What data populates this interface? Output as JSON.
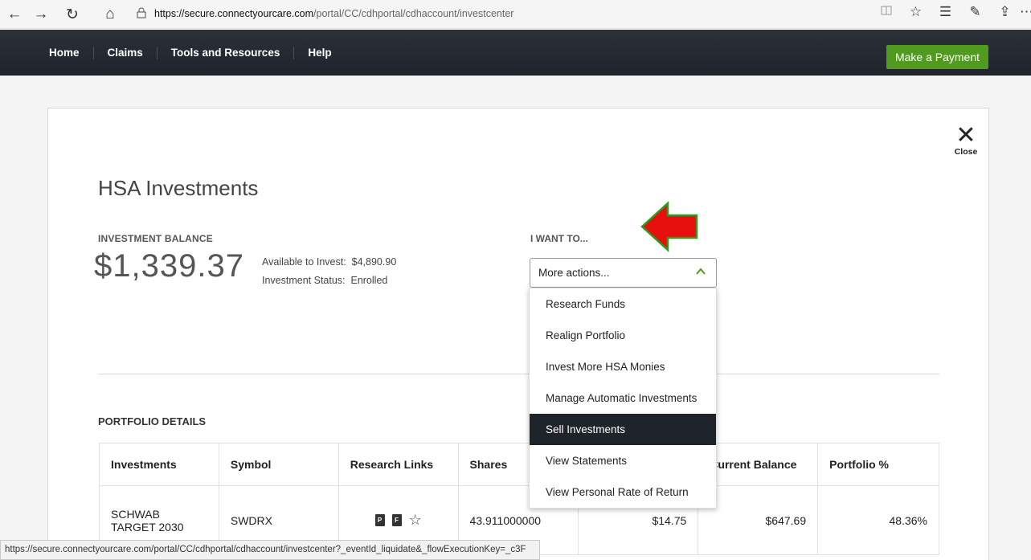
{
  "browser": {
    "url_host": "https://secure.connectyourcare.com",
    "url_path": "/portal/CC/cdhportal/cdhaccount/investcenter",
    "status_url": "https://secure.connectyourcare.com/portal/CC/cdhportal/cdhaccount/investcenter?_eventId_liquidate&_flowExecutionKey=_c3F",
    "icons": {
      "back": "←",
      "forward": "→",
      "refresh": "↻",
      "home": "⌂",
      "lock": "🔒",
      "reading": "📖",
      "favorite": "☆",
      "favorites_list": "☰",
      "pen": "✎",
      "share": "⇪",
      "more": "⋯"
    }
  },
  "topnav": {
    "items": [
      "Home",
      "Claims",
      "Tools and Resources",
      "Help"
    ],
    "payment_button": "Make a Payment"
  },
  "close": {
    "icon": "✕",
    "label": "Close"
  },
  "page_title": "HSA Investments",
  "balance": {
    "label": "INVESTMENT BALANCE",
    "amount": "$1,339.37",
    "available_label": "Available to Invest:",
    "available_value": "$4,890.90",
    "status_label": "Investment Status:",
    "status_value": "Enrolled"
  },
  "actions": {
    "label": "I WANT TO...",
    "selected": "More actions...",
    "options": [
      "Research Funds",
      "Realign Portfolio",
      "Invest More HSA Monies",
      "Manage Automatic Investments",
      "Sell Investments",
      "View Statements",
      "View Personal Rate of Return"
    ],
    "highlighted_index": 4
  },
  "portfolio": {
    "label": "PORTFOLIO DETAILS",
    "columns": [
      "Investments",
      "Symbol",
      "Research Links",
      "Shares",
      "",
      "Current Balance",
      "Portfolio %"
    ],
    "rows": [
      {
        "investment": "SCHWAB TARGET 2030",
        "symbol": "SWDRX",
        "links": [
          "P",
          "F"
        ],
        "shares": "43.911000000",
        "price": "$14.75",
        "balance": "$647.69",
        "percent": "48.36%"
      }
    ]
  },
  "colors": {
    "nav_bg": "#1f232a",
    "pay_green": "#4f9a1f",
    "arrow_red": "#e80f0f",
    "arrow_outline": "#2e9a1e"
  }
}
